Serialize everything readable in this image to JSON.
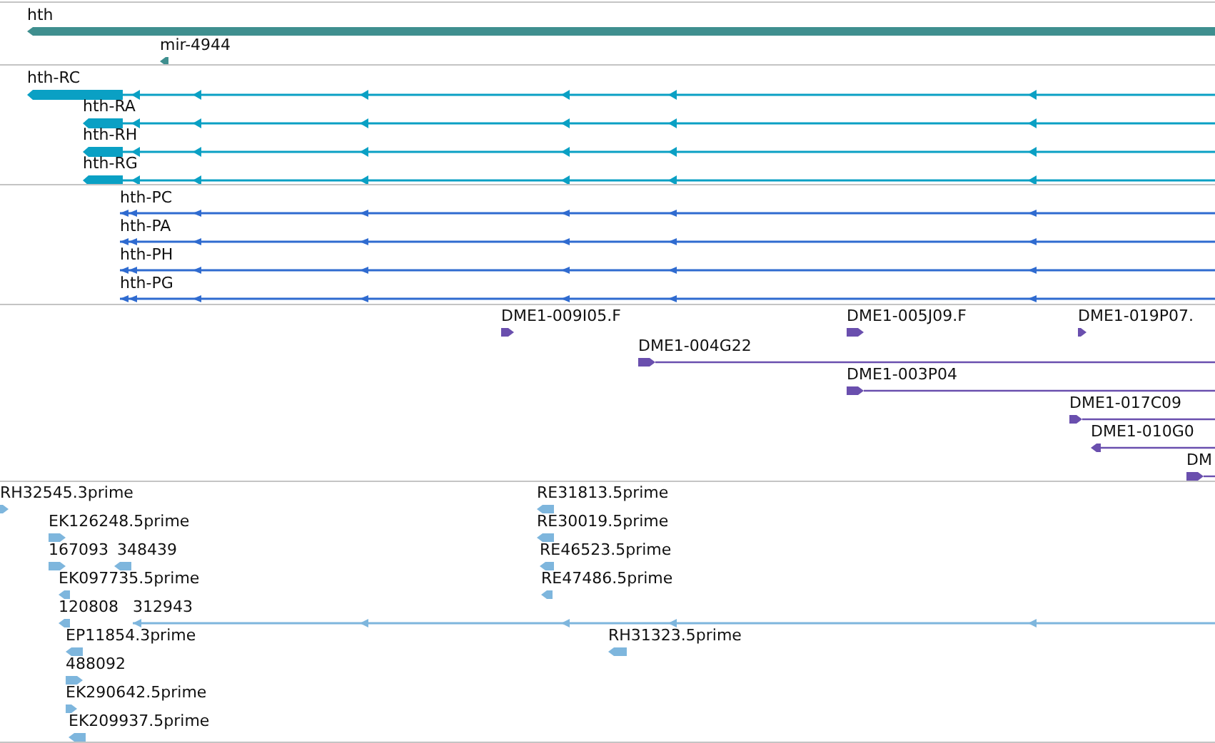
{
  "tracks": [
    {
      "kind": "gene",
      "color": "#3f8f8f",
      "features": [
        {
          "label": "hth",
          "reverse": true
        },
        {
          "label": "mir-4944",
          "reverse": true
        }
      ]
    },
    {
      "kind": "transcript",
      "color": "#0aa0c4",
      "features": [
        {
          "label": "hth-RC",
          "reverse": true
        },
        {
          "label": "hth-RA",
          "reverse": true
        },
        {
          "label": "hth-RH",
          "reverse": true
        },
        {
          "label": "hth-RG",
          "reverse": true
        }
      ]
    },
    {
      "kind": "protein",
      "color": "#2f6bd0",
      "features": [
        {
          "label": "hth-PC",
          "reverse": true
        },
        {
          "label": "hth-PA",
          "reverse": true
        },
        {
          "label": "hth-PH",
          "reverse": true
        },
        {
          "label": "hth-PG",
          "reverse": true
        }
      ]
    },
    {
      "kind": "clone",
      "color": "#6a4fae",
      "features": [
        {
          "label": "DME1-009I05.F",
          "reverse": false
        },
        {
          "label": "DME1-005J09.F",
          "reverse": false
        },
        {
          "label": "DME1-019P07.",
          "reverse": false
        },
        {
          "label": "DME1-004G22",
          "reverse": false
        },
        {
          "label": "DME1-003P04",
          "reverse": false
        },
        {
          "label": "DME1-017C09",
          "reverse": false
        },
        {
          "label": "DME1-010G0",
          "reverse": true
        },
        {
          "label": "DM",
          "reverse": false
        }
      ]
    },
    {
      "kind": "est",
      "color": "#7eb6dd",
      "features": [
        {
          "label": "RH32545.3prime",
          "reverse": false
        },
        {
          "label": "EK126248.5prime",
          "reverse": false
        },
        {
          "label": "167093",
          "reverse": false
        },
        {
          "label": "348439",
          "reverse": true
        },
        {
          "label": "EK097735.5prime",
          "reverse": true
        },
        {
          "label": "120808",
          "reverse": true
        },
        {
          "label": "312943",
          "reverse": true
        },
        {
          "label": "EP11854.3prime",
          "reverse": true
        },
        {
          "label": "488092",
          "reverse": false
        },
        {
          "label": "EK290642.5prime",
          "reverse": false
        },
        {
          "label": "EK209937.5prime",
          "reverse": true
        },
        {
          "label": "RE31813.5prime",
          "reverse": true
        },
        {
          "label": "RE30019.5prime",
          "reverse": true
        },
        {
          "label": "RE46523.5prime",
          "reverse": true
        },
        {
          "label": "RE47486.5prime",
          "reverse": true
        },
        {
          "label": "RH31323.5prime",
          "reverse": true
        }
      ]
    }
  ]
}
